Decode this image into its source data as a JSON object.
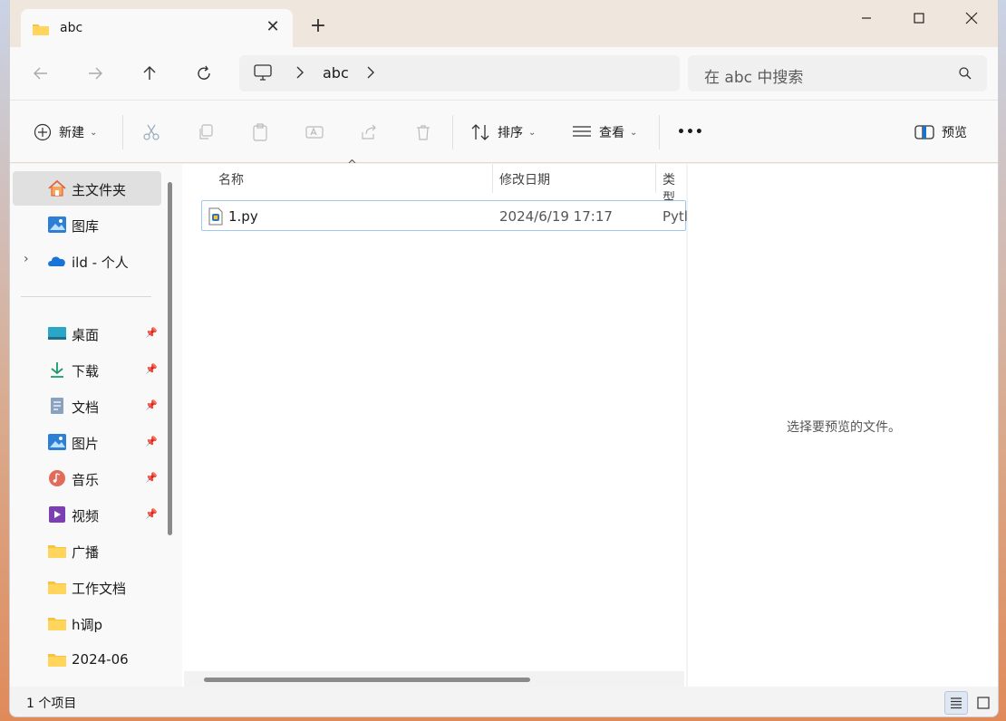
{
  "window": {
    "tab_title": "abc",
    "close_tab": "✕",
    "new_tab": "+"
  },
  "nav": {
    "address_segments": [
      "abc"
    ],
    "search_placeholder": "在 abc 中搜索"
  },
  "toolbar": {
    "new_label": "新建",
    "sort_label": "排序",
    "view_label": "查看",
    "more_label": "•••",
    "preview_label": "预览"
  },
  "sidebar": {
    "items": [
      {
        "label": "主文件夹",
        "icon": "home-icon"
      },
      {
        "label": "图库",
        "icon": "gallery-icon"
      },
      {
        "label": "ild - 个人",
        "icon": "onedrive-icon"
      },
      {
        "label": "桌面",
        "icon": "desktop-icon"
      },
      {
        "label": "下载",
        "icon": "download-icon"
      },
      {
        "label": "文档",
        "icon": "document-icon"
      },
      {
        "label": "图片",
        "icon": "pictures-icon"
      },
      {
        "label": "音乐",
        "icon": "music-icon"
      },
      {
        "label": "视频",
        "icon": "video-icon"
      },
      {
        "label": "广播",
        "icon": "folder-icon"
      },
      {
        "label": "工作文档",
        "icon": "folder-icon"
      },
      {
        "label": "h调p",
        "icon": "folder-icon"
      },
      {
        "label": "2024-06",
        "icon": "folder-icon"
      }
    ]
  },
  "content": {
    "columns": [
      "名称",
      "修改日期",
      "类型"
    ],
    "sort_indicator": "^",
    "files": [
      {
        "name": "1.py",
        "modified": "2024/6/19 17:17",
        "type": "Pytl"
      }
    ]
  },
  "preview": {
    "message": "选择要预览的文件。"
  },
  "status": {
    "count": "1 个项目"
  },
  "colors": {
    "accent": "#0067c0",
    "selection_border": "#9ec9ec",
    "folder": "#f5c242"
  }
}
